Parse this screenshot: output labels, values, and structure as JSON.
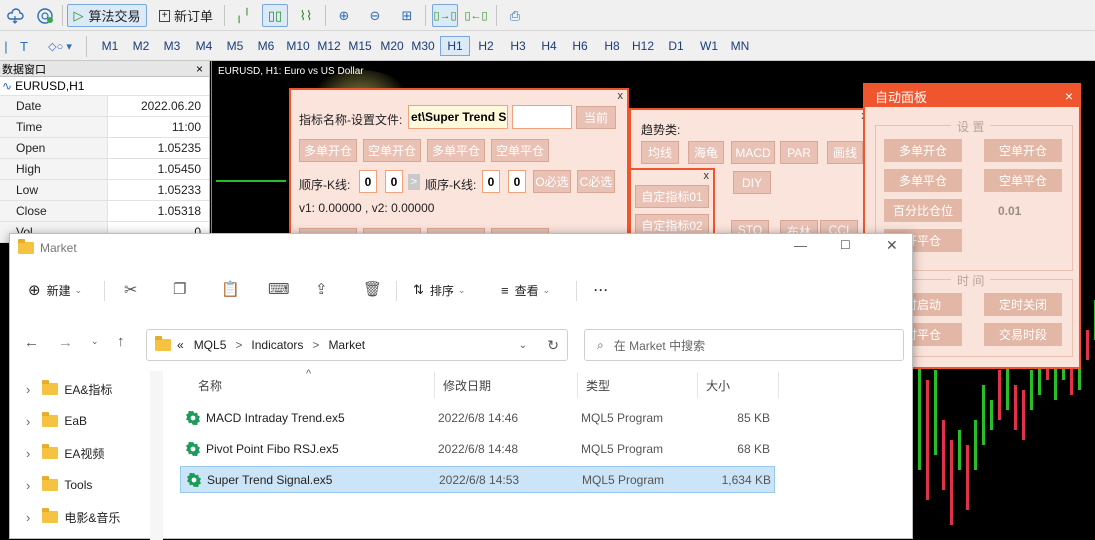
{
  "toolbar": {
    "algo_trading": "算法交易",
    "new_order": "新订单"
  },
  "timeframes": [
    "M1",
    "M2",
    "M3",
    "M4",
    "M5",
    "M6",
    "M10",
    "M12",
    "M15",
    "M20",
    "M30",
    "H1",
    "H2",
    "H3",
    "H4",
    "H6",
    "H8",
    "H12",
    "D1",
    "W1",
    "MN"
  ],
  "active_timeframe": "H1",
  "data_window": {
    "title": "数据窗口",
    "symbol": "EURUSD,H1",
    "rows": [
      {
        "k": "Date",
        "v": "2022.06.20"
      },
      {
        "k": "Time",
        "v": "11:00"
      },
      {
        "k": "Open",
        "v": "1.05235"
      },
      {
        "k": "High",
        "v": "1.05450"
      },
      {
        "k": "Low",
        "v": "1.05233"
      },
      {
        "k": "Close",
        "v": "1.05318"
      },
      {
        "k": "Vol",
        "v": "0"
      }
    ]
  },
  "chart": {
    "title": "EURUSD, H1:  Euro vs US Dollar"
  },
  "indicator_panel": {
    "name_label": "指标名称-设置文件:",
    "name_value": "et\\Super Trend Si",
    "current_button": "当前",
    "buttons_row1": [
      "多单开仓",
      "空单开仓",
      "多单平仓",
      "空单平仓"
    ],
    "seq_label1": "顺序-K线:",
    "seq_label2": "顺序-K线:",
    "v1": "0",
    "v2": "0",
    "v3": "0",
    "v4": "0",
    "arrow": ">",
    "o_select": "O必选",
    "c_select": "C必选",
    "values_line": "v1: 0.00000 , v2: 0.00000"
  },
  "trend_panel": {
    "label": "趋势类:",
    "buttons": [
      "均线",
      "海龟",
      "MACD",
      "PAR",
      "画线"
    ],
    "diy": "DIY",
    "custom": [
      "自定指标01",
      "自定指标02"
    ],
    "partial": [
      "STO",
      "布林",
      "CCI"
    ]
  },
  "auto_panel": {
    "title": "自动面板",
    "settings_heading": "设 置",
    "buttons": [
      "多单开仓",
      "空单开仓",
      "多单平仓",
      "空单平仓",
      "百分比仓位"
    ],
    "percent_value": "0.01",
    "partial_btn": "开平仓",
    "time_heading": "时 间",
    "time_buttons": [
      "时启动",
      "定时关闭",
      "时平仓",
      "交易时段"
    ]
  },
  "explorer": {
    "title": "Market",
    "cmd": {
      "new": "新建",
      "sort": "排序",
      "view": "查看",
      "more": "···"
    },
    "breadcrumb": [
      "«",
      "MQL5",
      ">",
      "Indicators",
      ">",
      "Market"
    ],
    "search_placeholder": "在 Market 中搜索",
    "tree": [
      "EA&指标",
      "EaB",
      "EA视频",
      "Tools",
      "电影&音乐"
    ],
    "columns": [
      "名称",
      "修改日期",
      "类型",
      "大小"
    ],
    "files": [
      {
        "name": "MACD Intraday Trend.ex5",
        "date": "2022/6/8 14:46",
        "type": "MQL5 Program",
        "size": "85 KB"
      },
      {
        "name": "Pivot Point Fibo RSJ.ex5",
        "date": "2022/6/8 14:48",
        "type": "MQL5 Program",
        "size": "68 KB"
      },
      {
        "name": "Super Trend Signal.ex5",
        "date": "2022/6/8 14:53",
        "type": "MQL5 Program",
        "size": "1,634 KB"
      }
    ],
    "selected_index": 2
  },
  "colors": {
    "panel_border": "#f0562e",
    "panel_bg": "#fbe4dc",
    "selection": "#cce4f7",
    "candle_up": "#26c026",
    "candle_down": "#e0324a"
  }
}
